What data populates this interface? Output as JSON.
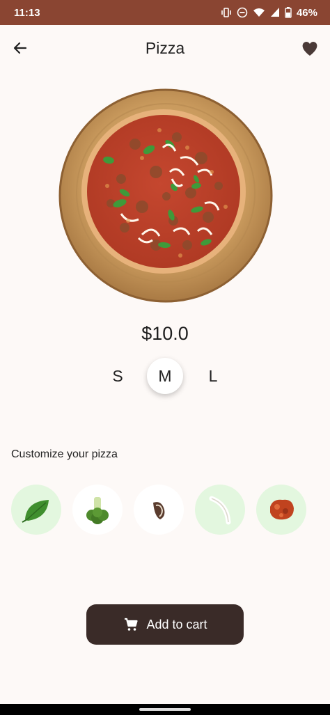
{
  "status_bar": {
    "time": "11:13",
    "battery": "46%",
    "icons": [
      "vibrate-icon",
      "dnd-icon",
      "wifi-icon",
      "signal-icon",
      "battery-icon"
    ]
  },
  "app_bar": {
    "title": "Pizza",
    "back_icon": "arrow-back-icon",
    "favorite_icon": "heart-icon"
  },
  "product": {
    "image": "pizza-on-wooden-board",
    "price": "$10.0"
  },
  "sizes": {
    "options": [
      "S",
      "M",
      "L"
    ],
    "selected": "M"
  },
  "customize": {
    "label": "Customize your pizza",
    "toppings": [
      {
        "name": "basil",
        "selected": true
      },
      {
        "name": "broccoli",
        "selected": false
      },
      {
        "name": "mushroom",
        "selected": false
      },
      {
        "name": "onion",
        "selected": true
      },
      {
        "name": "sausage",
        "selected": true
      }
    ]
  },
  "cart": {
    "label": "Add to cart",
    "icon": "cart-icon"
  },
  "colors": {
    "status_bar": "#8a4532",
    "background": "#fdf9f7",
    "button": "#3a2b28",
    "topping_selected": "#e3f7df"
  }
}
